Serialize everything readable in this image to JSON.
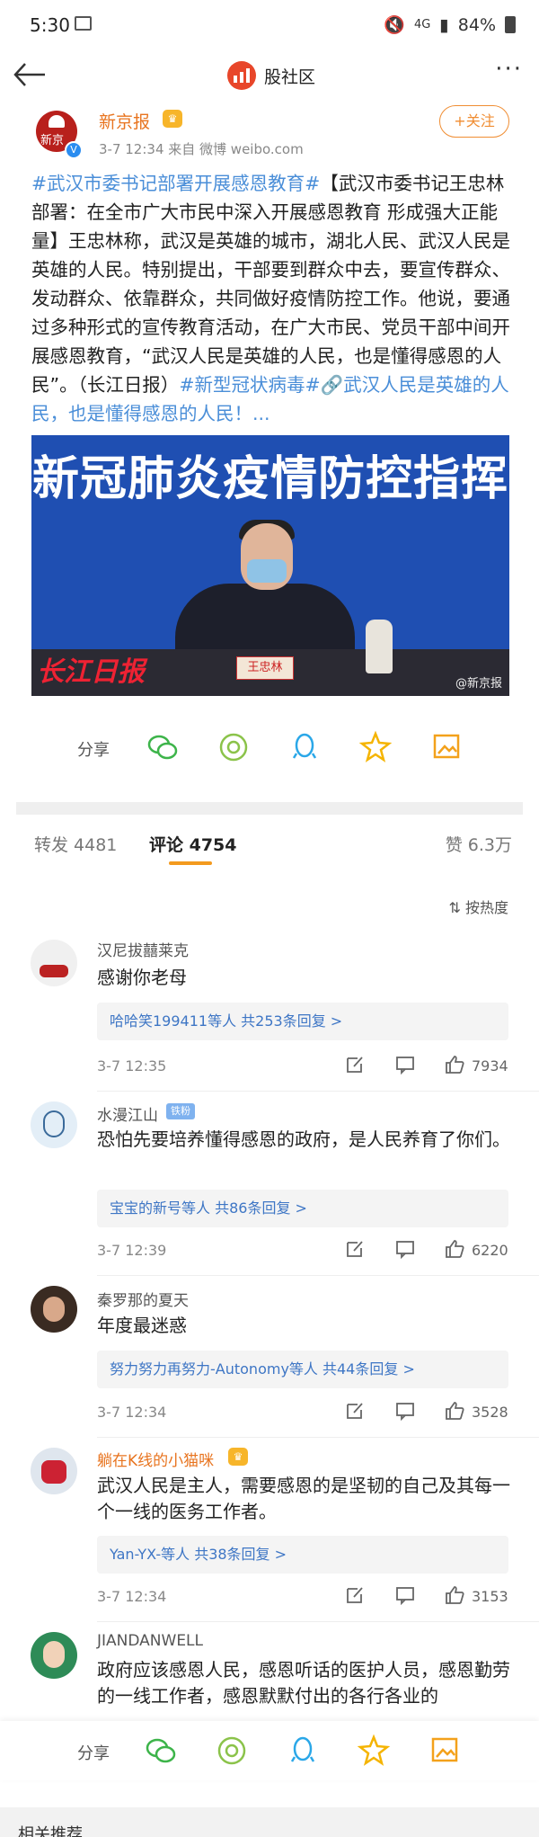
{
  "status": {
    "time": "5:30",
    "battery": "84%",
    "icons": [
      "image-icon",
      "mute-icon",
      "4g-icon",
      "signal-icon",
      "battery-icon"
    ]
  },
  "nav": {
    "title": "股社区"
  },
  "post": {
    "author": "新京报",
    "avatar_text": "新京",
    "meta": "3-7 12:34  来自 微博 weibo.com",
    "follow_label": "+关注",
    "text_parts": [
      {
        "text": "#武汉市委书记部署开展感恩教育#",
        "tag": true
      },
      {
        "text": "【武汉市委书记王忠林部署：在全市广大市民中深入开展感恩教育 形成强大正能量】王忠林称，武汉是英雄的城市，湖北人民、武汉人民是英雄的人民。特别提出，干部要到群众中去，要宣传群众、发动群众、依靠群众，共同做好疫情防控工作。他说，要通过多种形式的宣传教育活动，在广大市民、党员干部中间开展感恩教育，“武汉人民是英雄的人民，也是懂得感恩的人民”。（长江日报）",
        "tag": false
      },
      {
        "text": "#新型冠状病毒#",
        "tag": true
      },
      {
        "text": "🔗武汉人民是英雄的人民，也是懂得感恩的人民！...",
        "tag": true
      }
    ],
    "image": {
      "headline": "新冠肺炎疫情防控指挥",
      "nameplate": "王忠林",
      "stamp": "长江日报",
      "watermark": "@新京报"
    }
  },
  "share_label": "分享",
  "tabs": {
    "repost": "转发 4481",
    "comments": "评论 4754",
    "likes": "赞 6.3万"
  },
  "sort_label": "按热度",
  "comments": [
    {
      "name": "汉尼拔囍莱克",
      "text": "感谢你老母",
      "reply": "哈哈笑199411等人  共253条回复 >",
      "time": "3-7 12:35",
      "likes": "7934"
    },
    {
      "name": "水漫江山",
      "badge": "铁粉",
      "text": "恐怕先要培养懂得感恩的政府，是人民养育了你们。",
      "reply": "宝宝的新号等人  共86条回复 >",
      "time": "3-7 12:39",
      "likes": "6220"
    },
    {
      "name": "秦罗那的夏天",
      "text": "年度最迷惑",
      "reply": "努力努力再努力-Autonomy等人  共44条回复 >",
      "time": "3-7 12:34",
      "likes": "3528"
    },
    {
      "name": "躺在K线的小猫咪",
      "text": "武汉人民是主人，需要感恩的是坚韧的自己及其每一个一线的医务工作者。",
      "reply": "Yan-YX-等人  共38条回复 >",
      "time": "3-7 12:34",
      "likes": "3153"
    },
    {
      "name": "JIANDANWELL",
      "text": "政府应该感恩人民，感恩听话的医护人员，感恩勤劳的一线工作者，感恩默默付出的各行各业的"
    }
  ],
  "related": "相关推荐",
  "colors": {
    "accent": "#f08d32",
    "link": "#3e76c5",
    "tag": "#4a8ed8"
  }
}
